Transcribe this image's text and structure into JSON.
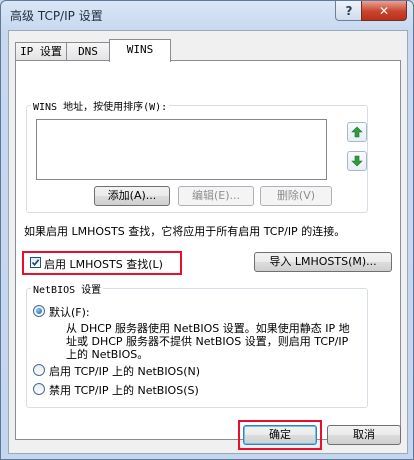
{
  "window": {
    "title": "高级 TCP/IP 设置",
    "help_glyph": "?",
    "close_glyph": "✕"
  },
  "tabs": [
    {
      "label": "IP 设置",
      "active": false
    },
    {
      "label": "DNS",
      "active": false
    },
    {
      "label": "WINS",
      "active": true
    }
  ],
  "wins": {
    "group_label": "WINS 地址，按使用排序(W):",
    "add_label": "添加(A)...",
    "edit_label": "编辑(E)...",
    "delete_label": "删除(V)",
    "lmhosts_description": "如果启用 LMHOSTS 查找，它将应用于所有启用 TCP/IP 的连接。",
    "enable_lmhosts_label": "启用 LMHOSTS 查找(L)",
    "enable_lmhosts_checked": true,
    "import_lmhosts_label": "导入 LMHOSTS(M)..."
  },
  "netbios": {
    "group_label": "NetBIOS 设置",
    "default_label": "默认(F):",
    "default_desc_line1": "从 DHCP 服务器使用 NetBIOS 设置。如果使用静态 IP 地",
    "default_desc_line2": "址或 DHCP 服务器不提供 NetBIOS 设置，则启用 TCP/IP",
    "default_desc_line3": "上的 NetBIOS。",
    "enable_label": "启用 TCP/IP 上的 NetBIOS(N)",
    "disable_label": "禁用 TCP/IP 上的 NetBIOS(S)",
    "selected": "default"
  },
  "footer": {
    "ok_label": "确定",
    "cancel_label": "取消"
  },
  "colors": {
    "highlight": "#e8102a",
    "arrow_green": "#2e9d3c"
  }
}
